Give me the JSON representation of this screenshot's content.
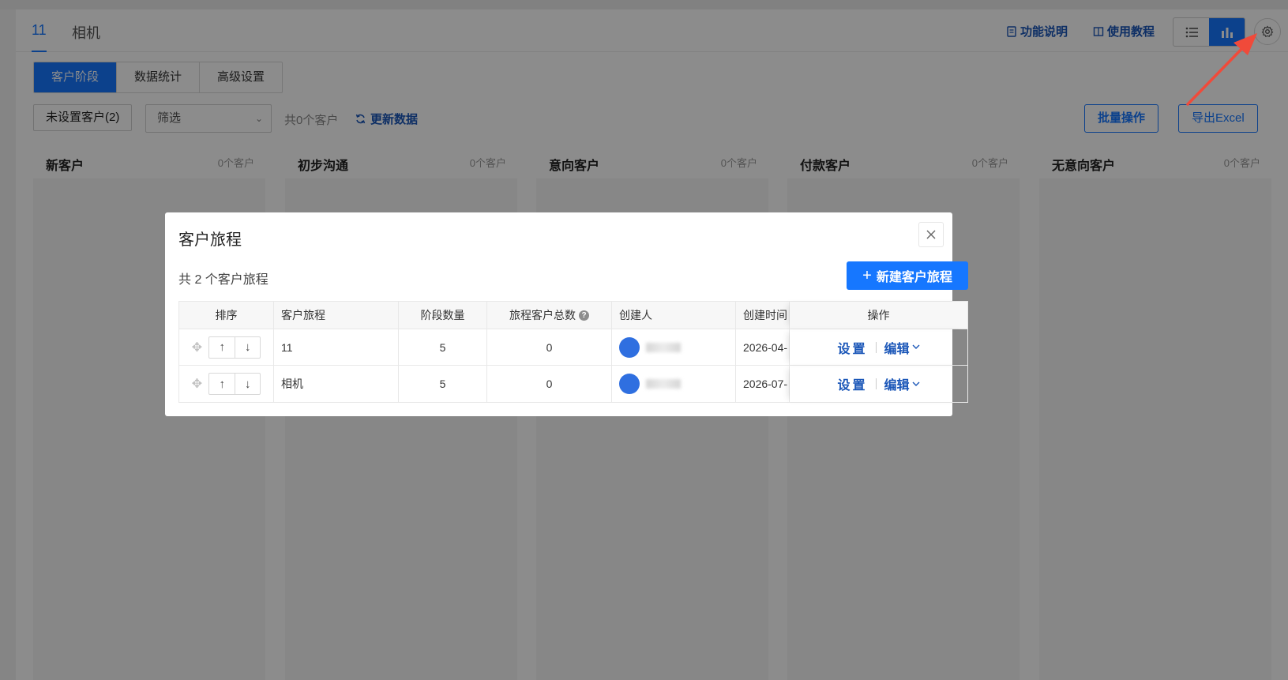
{
  "header": {
    "journey_tabs": [
      {
        "label": "11",
        "active": true
      },
      {
        "label": "相机",
        "active": false
      }
    ],
    "feature_doc_label": "功能说明",
    "tutorial_label": "使用教程",
    "view_modes": [
      "list-icon",
      "bar-chart-icon"
    ],
    "active_view": "bar-chart-icon"
  },
  "subtabs": [
    {
      "label": "客户阶段",
      "active": true
    },
    {
      "label": "数据统计",
      "active": false
    },
    {
      "label": "高级设置",
      "active": false
    }
  ],
  "toolbar": {
    "unset_customers_label": "未设置客户(2)",
    "filter_placeholder": "筛选",
    "customer_count": "共0个客户",
    "refresh_label": "更新数据",
    "batch_label": "批量操作",
    "export_label": "导出Excel"
  },
  "stages": [
    {
      "name": "新客户",
      "count": "0个客户"
    },
    {
      "name": "初步沟通",
      "count": "0个客户"
    },
    {
      "name": "意向客户",
      "count": "0个客户"
    },
    {
      "name": "付款客户",
      "count": "0个客户"
    },
    {
      "name": "无意向客户",
      "count": "0个客户"
    }
  ],
  "modal": {
    "title": "客户旅程",
    "summary": "共 2 个客户旅程",
    "new_button_label": "新建客户旅程",
    "columns": [
      "排序",
      "客户旅程",
      "阶段数量",
      "旅程客户总数",
      "创建人",
      "创建时间",
      "操作"
    ],
    "rows": [
      {
        "name": "11",
        "stage_count": "5",
        "customer_total": "0",
        "created_at": "2026-04-",
        "op_settings": "设置",
        "op_edit": "编辑"
      },
      {
        "name": "相机",
        "stage_count": "5",
        "customer_total": "0",
        "created_at": "2026-07-",
        "op_settings": "设置",
        "op_edit": "编辑"
      }
    ]
  },
  "colors": {
    "accent": "#1677ff",
    "link": "#1a56b8",
    "annotation": "#f04a3a"
  }
}
